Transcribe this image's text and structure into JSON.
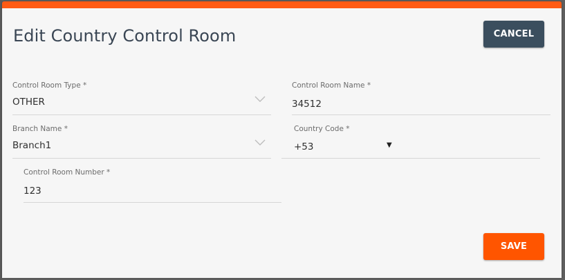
{
  "dialog": {
    "title": "Edit Country Control Room",
    "accent_color": "#ff5b14",
    "cancel_label": "CANCEL",
    "save_label": "SAVE"
  },
  "fields": {
    "control_room_type": {
      "label": "Control Room Type *",
      "value": "OTHER"
    },
    "control_room_name": {
      "label": "Control Room Name *",
      "value": "34512"
    },
    "branch_name": {
      "label": "Branch Name *",
      "value": "Branch1"
    },
    "country_code": {
      "label": "Country Code *",
      "value": "+53"
    },
    "control_room_number": {
      "label": "Control Room Number *",
      "value": "123"
    }
  },
  "icons": {
    "dropdown_chevron": "chevron-down-icon",
    "dropdown_caret": "caret-down-icon",
    "caret_glyph": "▼"
  }
}
